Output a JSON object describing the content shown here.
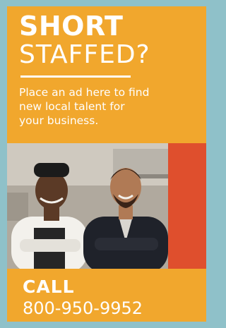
{
  "ad": {
    "headline_line1": "SHORT",
    "headline_line2": "STAFFED?",
    "body_line1": "Place an ad here to find",
    "body_line2": "new local talent for",
    "body_line3": "your business.",
    "call_label": "CALL",
    "phone": "800-950-9952"
  },
  "colors": {
    "frame": "#8fc1c9",
    "ad_background": "#f1a72d",
    "accent_bar": "#df4f2d",
    "text": "#ffffff"
  }
}
